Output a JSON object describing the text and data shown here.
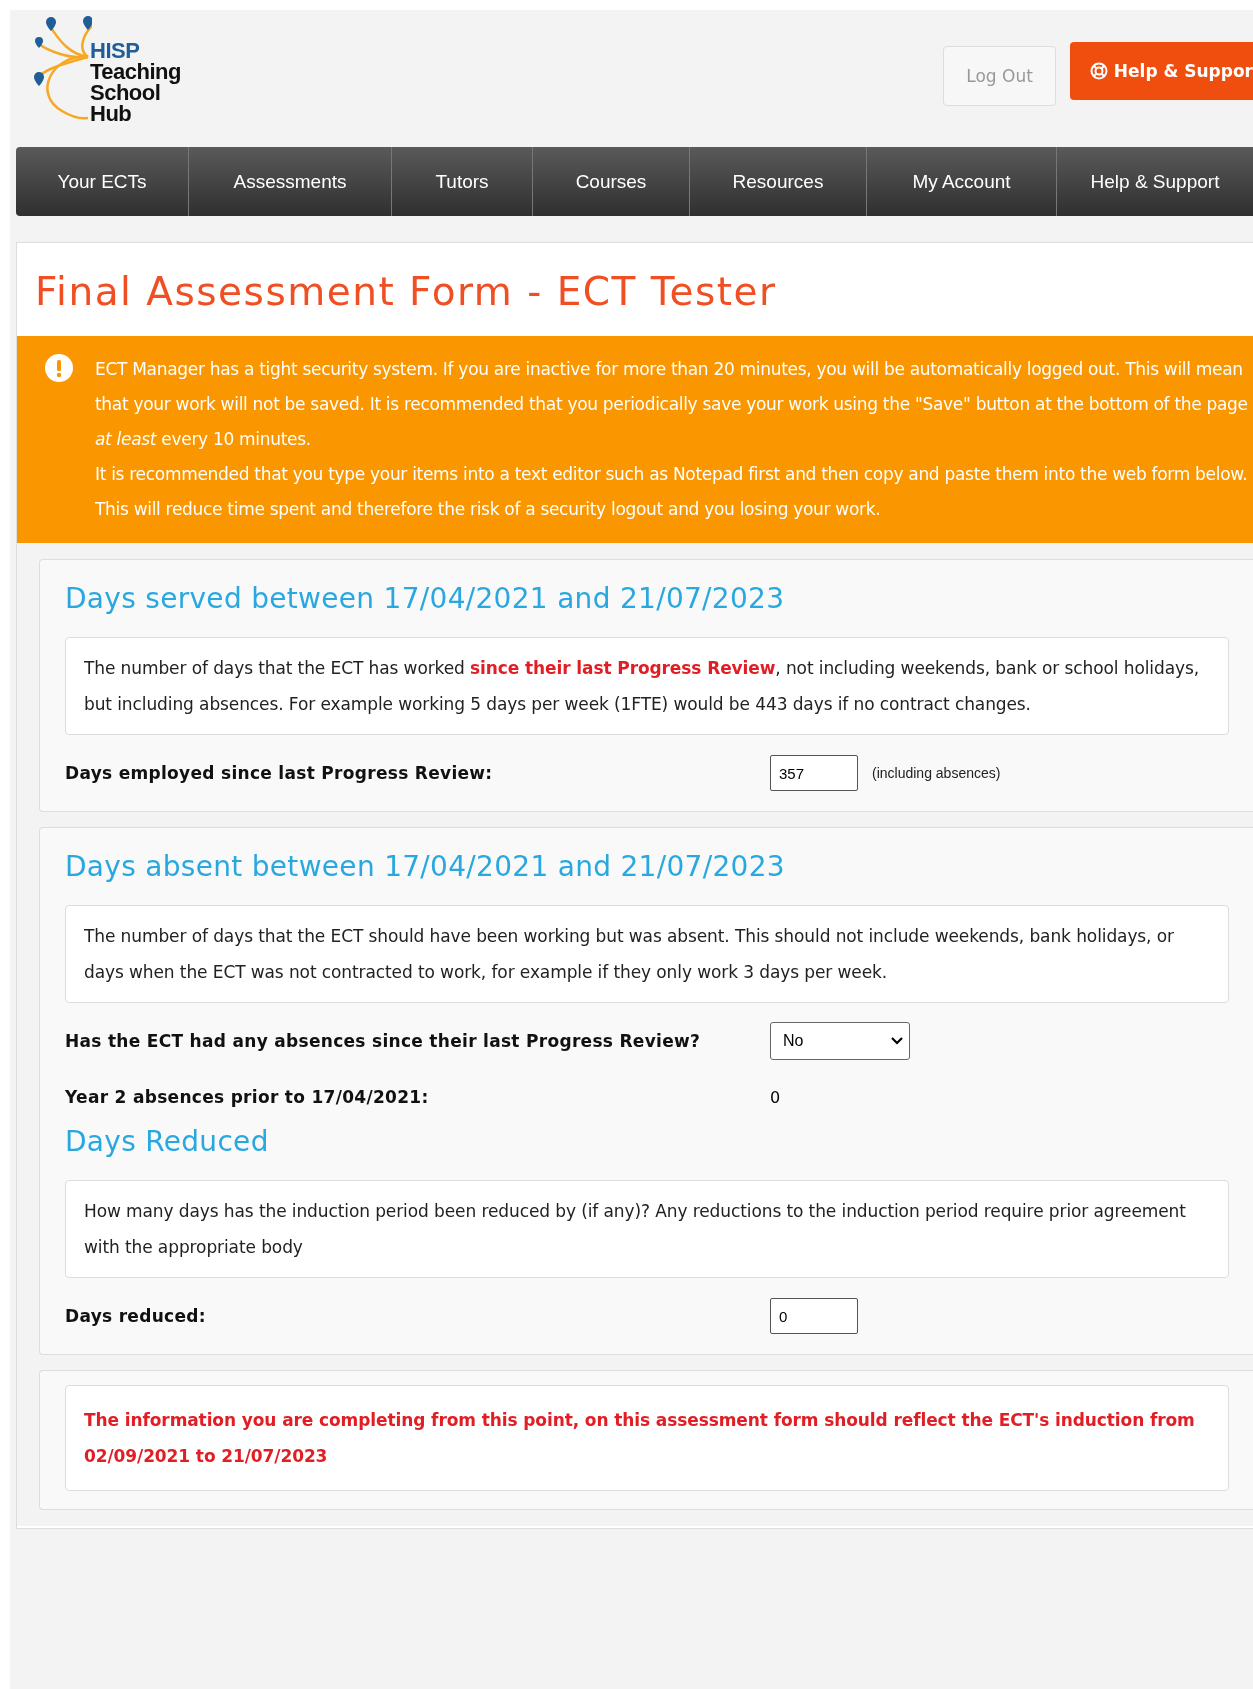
{
  "header": {
    "logo_lines": [
      "HISP",
      "Teaching",
      "School",
      "Hub"
    ],
    "buttons": [
      {
        "label": "Log Out",
        "kind": "plain"
      },
      {
        "label": "Help & Suppor",
        "kind": "primary"
      }
    ]
  },
  "nav": [
    "Your ECTs",
    "Assessments",
    "Tutors",
    "Courses",
    "Resources",
    "My Account",
    "Help & Support"
  ],
  "title": "Final Assessment Form - ECT Tester",
  "alert": {
    "paragraphs": [
      "ECT Manager has a tight security system. If you are inactive for more than 20 minutes, you will be automatically logged out. This will mean that your work will not be saved. It is recommended that you periodically save your work using the \"Save\" button at the bottom of the page *at least* every 10 minutes.",
      "It is recommended that you type your items into a text editor such as Notepad first and then copy and paste them into the web form below. This will reduce time spent and therefore the risk of a security logout and you losing your work."
    ]
  },
  "sections": [
    {
      "blocks": [
        {
          "kind": "heading",
          "text": "Days served between 17/04/2021 and 21/07/2023"
        },
        {
          "kind": "info",
          "text": "The number of days that the ECT has worked **since their last Progress Review**, not including weekends, bank or school holidays, but including absences. For example working 5 days per week (1FTE) would be 443 days if no contract changes."
        },
        {
          "kind": "input",
          "label": "Days employed since last Progress Review:",
          "value": "357",
          "note": "(including absences)"
        }
      ]
    },
    {
      "blocks": [
        {
          "kind": "heading",
          "text": "Days absent between 17/04/2021 and 21/07/2023"
        },
        {
          "kind": "info",
          "text": "The number of days that the ECT should have been working but was absent. This should not include weekends, bank holidays, or days when the ECT was not contracted to work, for example if they only work 3 days per week."
        },
        {
          "kind": "select",
          "label": "Has the ECT had any absences since their last Progress Review?",
          "value": "No"
        },
        {
          "kind": "text",
          "label": "Year 2 absences prior to 17/04/2021:",
          "value": "0"
        },
        {
          "kind": "heading",
          "text": "Days Reduced"
        },
        {
          "kind": "info",
          "text": "How many days has the induction period been reduced by (if any)? Any reductions to the induction period require prior agreement with the appropriate body"
        },
        {
          "kind": "input",
          "label": "Days reduced:",
          "value": "0"
        }
      ]
    },
    {
      "blocks": [
        {
          "kind": "notice",
          "text": "The information you are completing from this point, on this assessment form should reflect the ECT's induction from 02/09/2021 to 21/07/2023"
        }
      ]
    }
  ]
}
